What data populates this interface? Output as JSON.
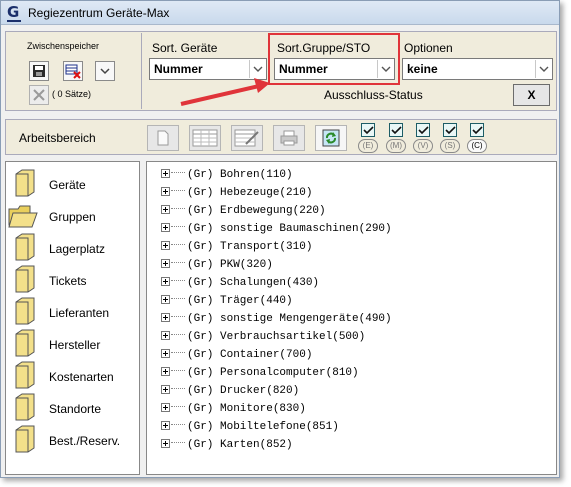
{
  "window": {
    "title": "Regiezentrum Geräte-Max",
    "app_icon": "G"
  },
  "zwischenspeicher": {
    "label": "Zwischenspeicher",
    "count": "( 0 Sätze)",
    "buttons": [
      "save-icon",
      "delete-records-icon",
      "chevron-down-icon",
      "close-icon"
    ]
  },
  "sort_geraete": {
    "label": "Sort. Geräte",
    "value": "Nummer"
  },
  "sort_gruppe": {
    "label": "Sort.Gruppe/STO",
    "value": "Nummer"
  },
  "optionen": {
    "label": "Optionen",
    "value": "keine"
  },
  "ausschluss": {
    "label": "Ausschluss-Status",
    "value": "X"
  },
  "arbeitsbereich": {
    "label": "Arbeitsbereich",
    "tools": [
      "new-document-icon",
      "table-view-icon",
      "edit-table-icon",
      "print-icon",
      "refresh-icon"
    ],
    "filters": [
      {
        "label": "(E)",
        "checked": true,
        "active": false
      },
      {
        "label": "(M)",
        "checked": true,
        "active": false
      },
      {
        "label": "(V)",
        "checked": true,
        "active": false
      },
      {
        "label": "(S)",
        "checked": true,
        "active": false
      },
      {
        "label": "(C)",
        "checked": true,
        "active": true
      }
    ]
  },
  "sidebar": {
    "items": [
      {
        "label": "Geräte",
        "selected": false
      },
      {
        "label": "Gruppen",
        "selected": true
      },
      {
        "label": "Lagerplatz",
        "selected": false
      },
      {
        "label": "Tickets",
        "selected": false
      },
      {
        "label": "Lieferanten",
        "selected": false
      },
      {
        "label": "Hersteller",
        "selected": false
      },
      {
        "label": "Kostenarten",
        "selected": false
      },
      {
        "label": "Standorte",
        "selected": false
      },
      {
        "label": "Best./Reserv.",
        "selected": false
      }
    ]
  },
  "tree": {
    "items": [
      "(Gr) Bohren(110)",
      "(Gr) Hebezeuge(210)",
      "(Gr) Erdbewegung(220)",
      "(Gr) sonstige Baumaschinen(290)",
      "(Gr) Transport(310)",
      "(Gr) PKW(320)",
      "(Gr) Schalungen(430)",
      "(Gr) Träger(440)",
      "(Gr) sonstige Mengengeräte(490)",
      "(Gr) Verbrauchsartikel(500)",
      "(Gr) Container(700)",
      "(Gr) Personalcomputer(810)",
      "(Gr) Drucker(820)",
      "(Gr) Monitore(830)",
      "(Gr) Mobiltelefone(851)",
      "(Gr) Karten(852)"
    ]
  },
  "colors": {
    "highlight": "#e0343a",
    "toolbar_bg": "#f0ecdc",
    "folder": "#f3e08a"
  }
}
